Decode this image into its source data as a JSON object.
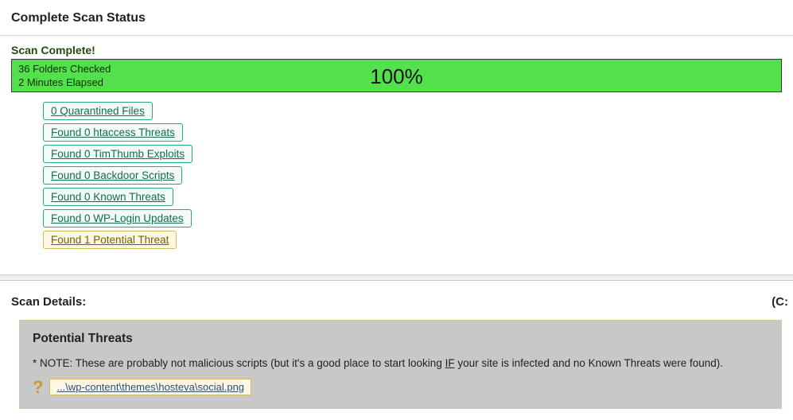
{
  "header": {
    "title": "Complete Scan Status"
  },
  "status": {
    "complete_label": "Scan Complete!",
    "folders_checked": "36 Folders Checked",
    "elapsed": "2 Minutes Elapsed",
    "percent": "100%"
  },
  "results": [
    {
      "label": "0 Quarantined Files",
      "kind": "green"
    },
    {
      "label": "Found 0 htaccess Threats",
      "kind": "green"
    },
    {
      "label": "Found 0 TimThumb Exploits",
      "kind": "green"
    },
    {
      "label": "Found 0 Backdoor Scripts",
      "kind": "green"
    },
    {
      "label": "Found 0 Known Threats",
      "kind": "green"
    },
    {
      "label": "Found 0 WP-Login Updates",
      "kind": "green"
    },
    {
      "label": "Found 1 Potential Threat",
      "kind": "yellow"
    }
  ],
  "details": {
    "heading": "Scan Details:",
    "drive": "(C:"
  },
  "threats": {
    "title": "Potential Threats",
    "note_prefix": "* NOTE: These are probably not malicious scripts (but it's a good place to start looking ",
    "note_if": "IF",
    "note_suffix": " your site is infected and no Known Threats were found).",
    "qmark": "?",
    "items": [
      {
        "path": "...\\wp-content\\themes\\hosteva\\social.png"
      }
    ]
  }
}
